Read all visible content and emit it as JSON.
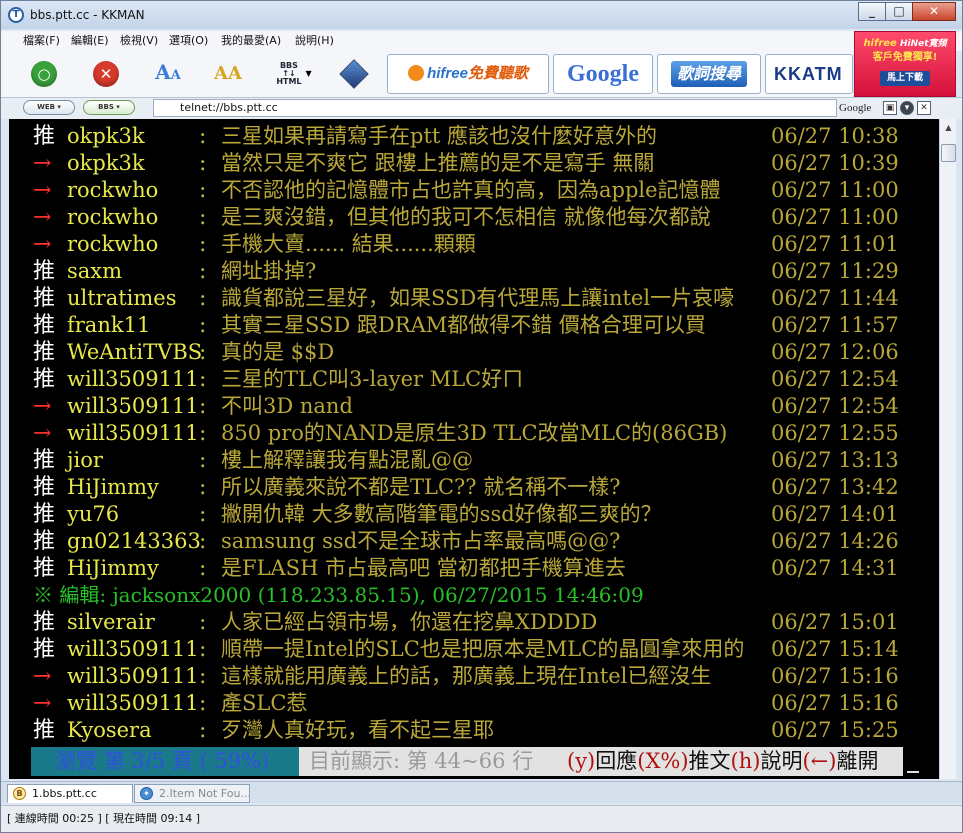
{
  "window": {
    "title": "bbs.ptt.cc - KKMAN",
    "app_icon_letter": "T",
    "min": "_",
    "max": "□",
    "close": "✕"
  },
  "menu": [
    "檔案(F)",
    "編輯(E)",
    "檢視(V)",
    "選項(O)",
    "我的最愛(A)",
    "說明(H)"
  ],
  "toolbar": {
    "go_symbol": "○",
    "stop_symbol": "✕",
    "font_a": "A",
    "bbs_html": [
      "BBS",
      "↑↓",
      "HTML"
    ],
    "hifree_text": "hifree",
    "hifree_zh": "免費聽歌",
    "google": "Google",
    "lyrics": "歌詞搜尋",
    "kkatm": "KKATM"
  },
  "ad": {
    "line1_brand": "hifree",
    "line1": " HiNet寬頻",
    "line2": "客戶免費獨享!",
    "button": "馬上下載"
  },
  "address_bar": {
    "web_label": "WEB ▾",
    "bbs_label": "BBS ▾",
    "url": "telnet://bbs.ptt.cc",
    "search_engine": "Google"
  },
  "terminal": {
    "rows": [
      {
        "tag": "推",
        "type": "push",
        "user": "okpk3k",
        "text": "三星如果再請寫手在ptt 應該也沒什麼好意外的",
        "time": "06/27 10:38"
      },
      {
        "tag": "→",
        "type": "arrow",
        "user": "okpk3k",
        "text": "當然只是不爽它 跟樓上推薦的是不是寫手 無關",
        "time": "06/27 10:39"
      },
      {
        "tag": "→",
        "type": "arrow",
        "user": "rockwho",
        "text": "不否認他的記憶體市占也許真的高，因為apple記憶體",
        "time": "06/27 11:00"
      },
      {
        "tag": "→",
        "type": "arrow",
        "user": "rockwho",
        "text": "是三爽沒錯，但其他的我可不怎相信  就像他每次都說",
        "time": "06/27 11:00"
      },
      {
        "tag": "→",
        "type": "arrow",
        "user": "rockwho",
        "text": "手機大賣......  結果......顆顆",
        "time": "06/27 11:01"
      },
      {
        "tag": "推",
        "type": "push",
        "user": "saxm",
        "text": "網址掛掉?",
        "time": "06/27 11:29"
      },
      {
        "tag": "推",
        "type": "push",
        "user": "ultratimes",
        "text": "識貨都說三星好，如果SSD有代理馬上讓intel一片哀嚎",
        "time": "06/27 11:44"
      },
      {
        "tag": "推",
        "type": "push",
        "user": "frank11",
        "text": "其實三星SSD 跟DRAM都做得不錯 價格合理可以買",
        "time": "06/27 11:57"
      },
      {
        "tag": "推",
        "type": "push",
        "user": "WeAntiTVBS",
        "text": "真的是 $$D",
        "time": "06/27 12:06"
      },
      {
        "tag": "推",
        "type": "push",
        "user": "will3509111",
        "text": "三星的TLC叫3-layer MLC好ㄇ",
        "time": "06/27 12:54"
      },
      {
        "tag": "→",
        "type": "arrow",
        "user": "will3509111",
        "text": "不叫3D nand",
        "time": "06/27 12:54"
      },
      {
        "tag": "→",
        "type": "arrow",
        "user": "will3509111",
        "text": "850 pro的NAND是原生3D TLC改當MLC的(86GB)",
        "time": "06/27 12:55"
      },
      {
        "tag": "推",
        "type": "push",
        "user": "jior",
        "text": "樓上解釋讓我有點混亂@@",
        "time": "06/27 13:13"
      },
      {
        "tag": "推",
        "type": "push",
        "user": "HiJimmy",
        "text": "所以廣義來說不都是TLC??  就名稱不一樣?",
        "time": "06/27 13:42"
      },
      {
        "tag": "推",
        "type": "push",
        "user": "yu76",
        "text": "撇開仇韓 大多數高階筆電的ssd好像都三爽的？",
        "time": "06/27 14:01"
      },
      {
        "tag": "推",
        "type": "push",
        "user": "gn02143363",
        "text": "samsung ssd不是全球市占率最高嗎@@?",
        "time": "06/27 14:26"
      },
      {
        "tag": "推",
        "type": "push",
        "user": "HiJimmy",
        "text": "是FLASH 市占最高吧  當初都把手機算進去",
        "time": "06/27 14:31"
      },
      {
        "type": "edit",
        "text": "※ 編輯: jacksonx2000 (118.233.85.15), 06/27/2015 14:46:09"
      },
      {
        "tag": "推",
        "type": "push",
        "user": "silverair",
        "text": "人家已經占領市場，你還在挖鼻XDDDD",
        "time": "06/27 15:01"
      },
      {
        "tag": "推",
        "type": "push",
        "user": "will3509111",
        "text": "順帶一提Intel的SLC也是把原本是MLC的晶圓拿來用的",
        "time": "06/27 15:14"
      },
      {
        "tag": "→",
        "type": "arrow",
        "user": "will3509111",
        "text": "這樣就能用廣義上的話，那廣義上現在Intel已經沒生",
        "time": "06/27 15:16"
      },
      {
        "tag": "→",
        "type": "arrow",
        "user": "will3509111",
        "text": "產SLC惹",
        "time": "06/27 15:16"
      },
      {
        "tag": "推",
        "type": "push",
        "user": "Kyosera",
        "text": "歹灣人真好玩，看不起三星耶",
        "time": "06/27 15:25"
      }
    ],
    "status": {
      "browse": "瀏覽 第 3/5 頁 ( 59%)",
      "info": "目前顯示: 第 44~66 行",
      "keys": [
        {
          "key": "(y)",
          "label": "回應"
        },
        {
          "key": "(X%)",
          "label": "推文"
        },
        {
          "key": "(h)",
          "label": "說明"
        },
        {
          "key": "(←)",
          "label": "離開"
        }
      ]
    }
  },
  "tabs": [
    {
      "icon": "B",
      "label": "1.bbs.ptt.cc"
    },
    {
      "icon": "✦",
      "label": "2.Item Not Fou..."
    }
  ],
  "statusbar": "[ 連線時間 00:25 ] [ 現在時間 09:14 ]"
}
